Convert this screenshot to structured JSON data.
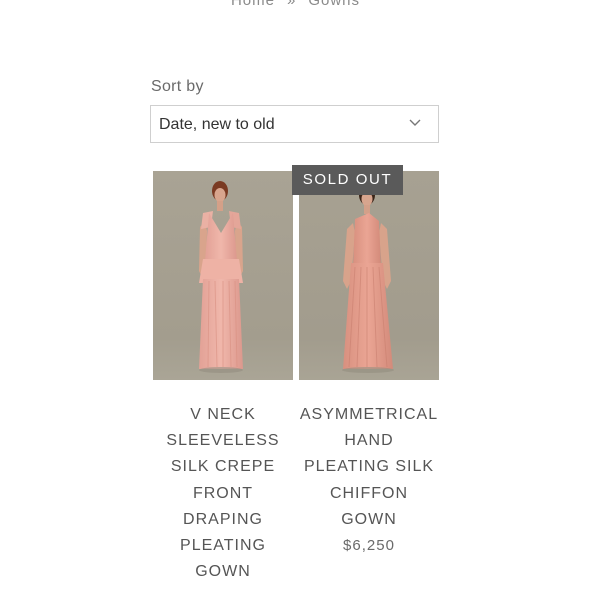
{
  "breadcrumb": {
    "home": "Home",
    "separator": "»",
    "current": "Gowns"
  },
  "sort": {
    "label": "Sort by",
    "selected": "Date, new to old",
    "icon": "chevron-down-icon"
  },
  "products": [
    {
      "title_lines": [
        "V NECK",
        "SLEEVELESS",
        "SILK CREPE",
        "FRONT",
        "DRAPING",
        "PLEATING",
        "GOWN"
      ],
      "price": "",
      "badge": ""
    },
    {
      "title_lines": [
        "ASYMMETRICAL",
        "HAND",
        "PLEATING SILK",
        "CHIFFON",
        "GOWN"
      ],
      "price": "$6,250",
      "badge": "SOLD OUT"
    }
  ],
  "colors": {
    "badge_bg": "#5a5a5a",
    "photo_bg": "#a8a293",
    "gown": "#e9a89c"
  }
}
